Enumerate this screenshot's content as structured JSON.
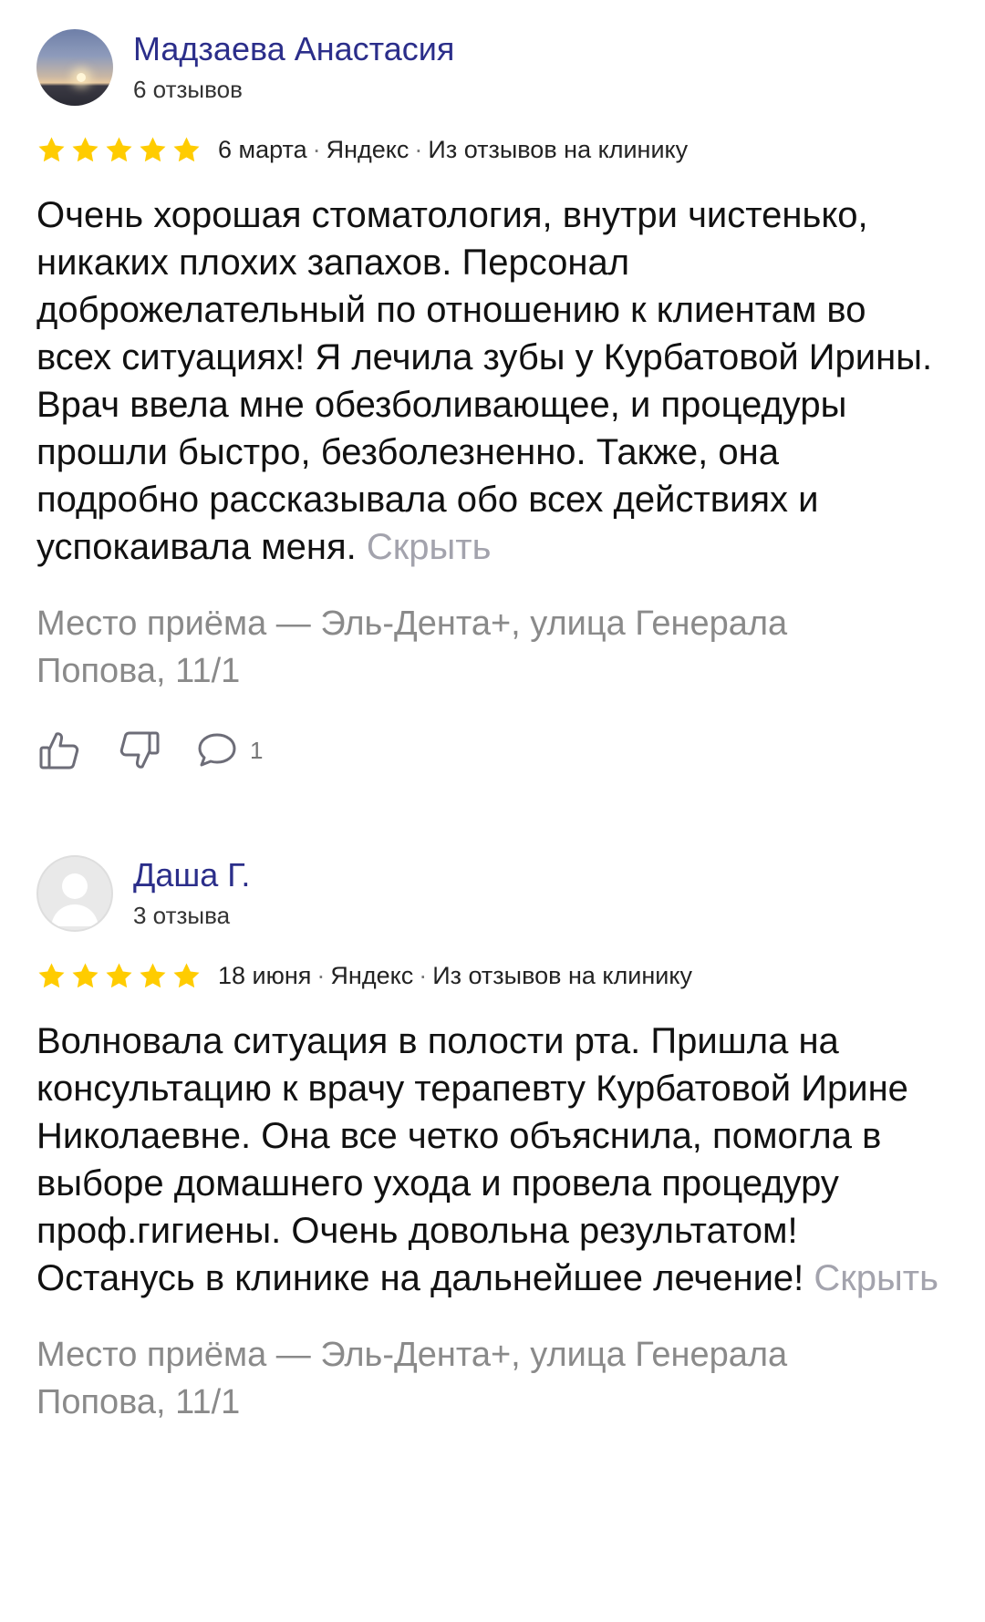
{
  "reviews": [
    {
      "author": "Мадзаева Анастасия",
      "review_count": "6 отзывов",
      "rating": 5,
      "date": "6 марта",
      "source": "Яндекс",
      "context": "Из отзывов на клинику",
      "text": "Очень хорошая стоматология, внутри чистенько, никаких плохих запахов. Персонал доброжелательный по отношению к клиентам во всех ситуациях! Я лечила зубы у Курбатовой Ирины. Врач ввела мне обезболивающее, и процедуры прошли быстро, безболезненно. Также, она подробно рассказывала обо всех действиях и успокаивала меня.",
      "hide_label": "Скрыть",
      "place": "Место приёма — Эль-Дента+, улица Генерала Попова, 11/1",
      "comments": "1"
    },
    {
      "author": "Даша Г.",
      "review_count": "3 отзыва",
      "rating": 5,
      "date": "18 июня",
      "source": "Яндекс",
      "context": "Из отзывов на клинику",
      "text": "Волновала ситуация в полости рта. Пришла на консультацию к врачу терапевту Курбатовой Ирине Николаевне. Она все четко объяснила, помогла в выборе домашнего ухода и провела процедуру проф.гигиены. Очень довольна результатом! Останусь в клинике на дальнейшее лечение!",
      "hide_label": "Скрыть",
      "place": "Место приёма — Эль-Дента+, улица Генерала Попова, 11/1"
    }
  ],
  "colors": {
    "author_name": "#2b2e8a",
    "star": "#ffcc00",
    "hide_link": "#a3a3ad",
    "place": "#8a8a8a"
  },
  "icons": [
    "star-icon",
    "thumbs-up-icon",
    "thumbs-down-icon",
    "comment-icon"
  ]
}
